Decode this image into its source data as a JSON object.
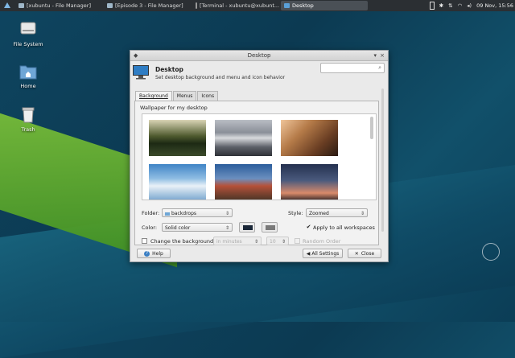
{
  "panel": {
    "tasks": [
      {
        "label": "[xubuntu - File Manager]",
        "active": false
      },
      {
        "label": "[Episode 3 - File Manager]",
        "active": false
      },
      {
        "label": "[Terminal - xubuntu@xubunt...",
        "active": false
      },
      {
        "label": "Desktop",
        "active": true
      }
    ],
    "clock": "09 Nov, 15:56"
  },
  "desktop_icons": [
    {
      "label": "File System",
      "icon": "drive-icon"
    },
    {
      "label": "Home",
      "icon": "folder-home-icon"
    },
    {
      "label": "Trash",
      "icon": "trash-icon"
    }
  ],
  "dialog": {
    "window_title": "Desktop",
    "header_title": "Desktop",
    "header_subtitle": "Set desktop background and menu and icon behavior",
    "search_placeholder": "",
    "tabs": [
      "Background",
      "Menus",
      "Icons"
    ],
    "active_tab": "Background",
    "section_label": "Wallpaper for my desktop",
    "folder_label": "Folder:",
    "folder_value": "backdrops",
    "style_label": "Style:",
    "style_value": "Zoomed",
    "color_label": "Color:",
    "color_value": "Solid color",
    "apply_all_label": "Apply to all workspaces",
    "apply_all_checked": true,
    "change_bg_label": "Change the background",
    "change_bg_checked": false,
    "interval_unit": "in minutes",
    "interval_value": "10",
    "random_label": "Random Order",
    "help_label": "Help",
    "all_settings_label": "All Settings",
    "close_label": "Close",
    "colors": {
      "primary": "#1a2738",
      "secondary": "#7a7a7a"
    }
  }
}
